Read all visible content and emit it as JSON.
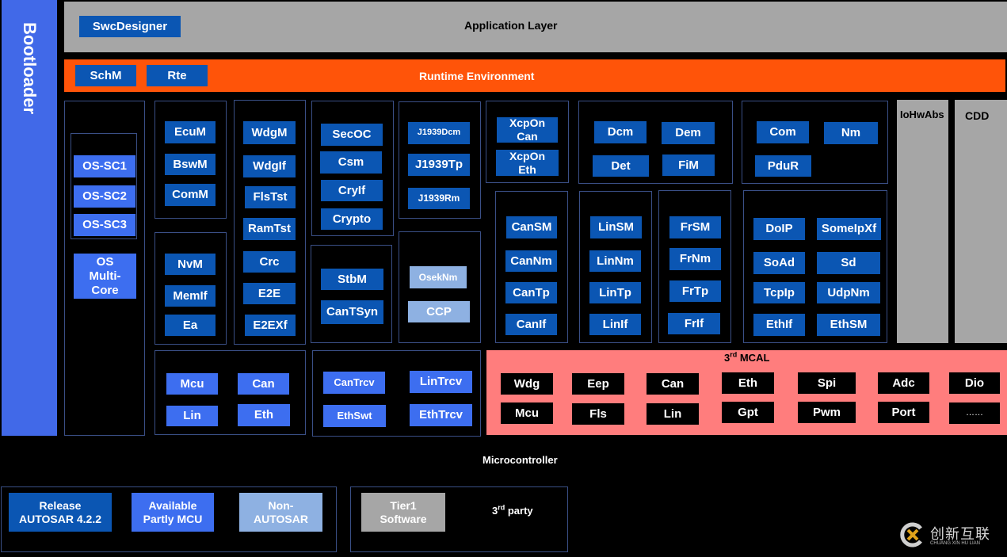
{
  "bootloader": "Bootloader",
  "application_layer": {
    "title": "Application Layer",
    "modules": [
      "SwcDesigner"
    ]
  },
  "runtime_environment": {
    "title": "Runtime Environment",
    "modules": [
      "SchM",
      "Rte"
    ]
  },
  "os": {
    "modules": [
      "OS-SC1",
      "OS-SC2",
      "OS-SC3"
    ],
    "multicore": "OS Multi-Core"
  },
  "ecu_group": [
    "EcuM",
    "BswM",
    "ComM"
  ],
  "memory_group": [
    "NvM",
    "MemIf",
    "Ea"
  ],
  "wdg_group": [
    "WdgM",
    "WdgIf",
    "FlsTst",
    "RamTst",
    "Crc",
    "E2E",
    "E2EXf"
  ],
  "security_group": [
    "SecOC",
    "Csm",
    "CryIf",
    "Crypto"
  ],
  "time_group": [
    "StbM",
    "CanTSyn"
  ],
  "j1939_group": [
    "J1939Dcm",
    "J1939Tp",
    "J1939Rm"
  ],
  "non_autosar_group": [
    "OsekNm",
    "CCP"
  ],
  "xcp_group": [
    "XcpOn Can",
    "XcpOn Eth"
  ],
  "can_group": [
    "CanSM",
    "CanNm",
    "CanTp",
    "CanIf"
  ],
  "diag_group": [
    "Dcm",
    "Dem",
    "Det",
    "FiM"
  ],
  "com_group": [
    "Com",
    "Nm",
    "PduR"
  ],
  "lin_group": [
    "LinSM",
    "LinNm",
    "LinTp",
    "LinIf"
  ],
  "fr_group": [
    "FrSM",
    "FrNm",
    "FrTp",
    "FrIf"
  ],
  "eth_group": [
    "DoIP",
    "SomeIpXf",
    "SoAd",
    "Sd",
    "TcpIp",
    "UdpNm",
    "EthIf",
    "EthSM"
  ],
  "iohwabs": "IoHwAbs",
  "cdd": "CDD",
  "mcal_driver_group": [
    "Mcu",
    "Can",
    "Lin",
    "Eth"
  ],
  "trcv_group": [
    "CanTrcv",
    "LinTrcv",
    "EthSwt",
    "EthTrcv"
  ],
  "third_mcal": {
    "title_prefix": "3",
    "title_sup": "rd",
    "title_suffix": " MCAL",
    "modules": [
      "Wdg",
      "Eep",
      "Can",
      "Eth",
      "Spi",
      "Adc",
      "Dio",
      "Mcu",
      "Fls",
      "Lin",
      "Gpt",
      "Pwm",
      "Port",
      "……"
    ]
  },
  "microcontroller": "Microcontroller",
  "legend": {
    "release": "Release AUTOSAR 4.2.2",
    "available": "Available Partly MCU",
    "non_autosar": "Non- AUTOSAR",
    "tier1": "Tier1 Software",
    "third_party_prefix": "3",
    "third_party_sup": "rd",
    "third_party_suffix": " party"
  },
  "watermark": {
    "cn": "创新互联",
    "en": "CHUANG XIN HU LIAN"
  },
  "colors": {
    "bootloader": "#4169e8",
    "app_layer": "#a6a6a6",
    "rte": "#ff5409",
    "release_blue": "#0b56b3",
    "available_blue": "#3d6ef0",
    "non_autosar_blue": "#8eb1e2",
    "mcal_pink": "#ff7d7d",
    "tier1_gray": "#a6a6a6"
  }
}
